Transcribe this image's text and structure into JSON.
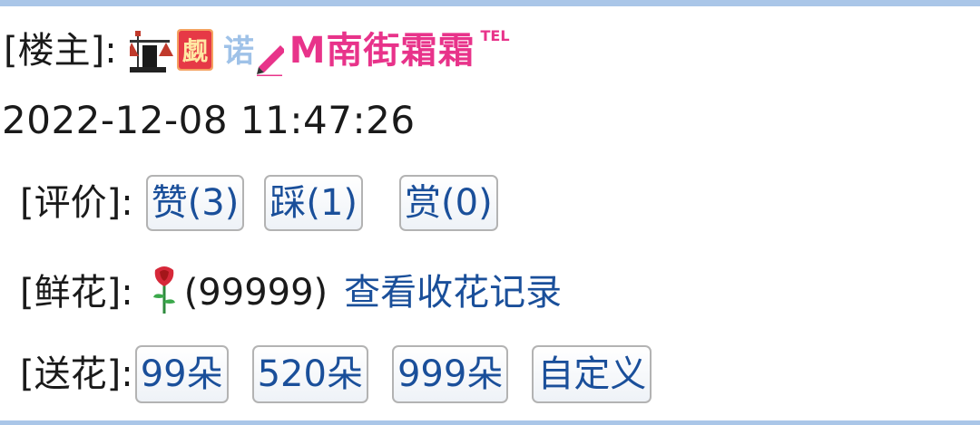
{
  "post": {
    "owner_label": "[楼主]",
    "owner_colon": ":",
    "user_name": "M南街霜霜",
    "user_tm": "TEL",
    "datetime": "2022-12-08 11:47:26"
  },
  "rating": {
    "label": "[评价]",
    "colon": ":",
    "buttons": [
      {
        "label": "赞(3)"
      },
      {
        "label": "踩(1)"
      },
      {
        "label": "赏(0)"
      }
    ]
  },
  "flowers": {
    "label": "[鲜花]",
    "colon": ":",
    "count": "(99999)",
    "link": "查看收花记录"
  },
  "send_flowers": {
    "label": "[送花]",
    "colon": ":",
    "options": [
      {
        "label": "99朵"
      },
      {
        "label": "520朵"
      },
      {
        "label": "999朵"
      },
      {
        "label": "自定义"
      }
    ]
  },
  "colors": {
    "link_blue": "#1a4f9a",
    "username_pink": "#e8338a",
    "border_blue": "#aac6e8"
  }
}
